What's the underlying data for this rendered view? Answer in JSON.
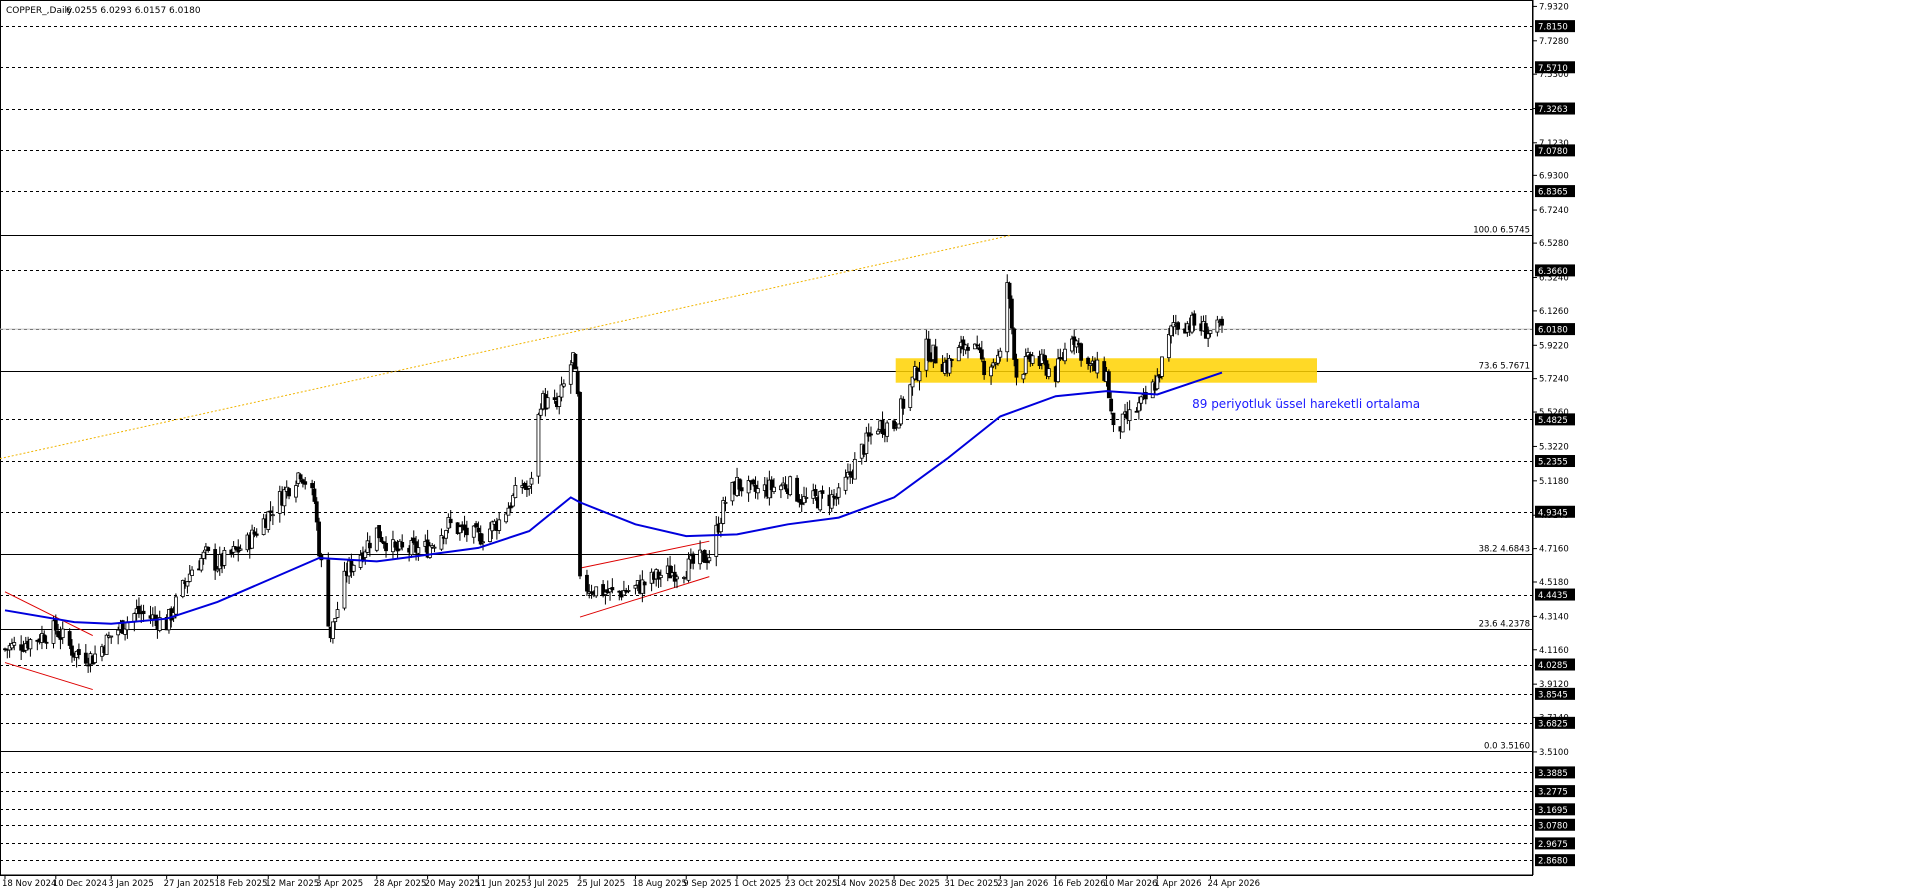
{
  "header": {
    "symbol": "COPPER_,Daily",
    "ohlc": "6.0255 6.0293 6.0157 6.0180"
  },
  "colors": {
    "background": "#ffffff",
    "grid": "#c0c0c0",
    "candle": "#000000",
    "ema": "#0000dd",
    "fib_line": "#000000",
    "fib_trend": "#f0b400",
    "zone": "#ffd200",
    "channel": "#dd0000",
    "price_box": "#000000",
    "price_text": "#ffffff",
    "annotation": "#1a1aff"
  },
  "price_axis": {
    "labels": [
      "7.9320",
      "7.7280",
      "7.5300",
      "7.3263",
      "7.1230",
      "6.9300",
      "6.7240",
      "6.5280",
      "6.3240",
      "6.1260",
      "5.9220",
      "5.7240",
      "5.5260",
      "5.3220",
      "5.1180",
      "4.9140",
      "4.7160",
      "4.5180",
      "4.3140",
      "4.1160",
      "3.9120",
      "3.7140",
      "3.5100"
    ],
    "boxed_levels": [
      "7.8150",
      "7.5710",
      "7.3263",
      "7.0780",
      "6.8365",
      "6.3660",
      "6.0180",
      "5.4825",
      "5.2355",
      "4.9345",
      "4.4435",
      "4.0285",
      "3.8545",
      "3.6825",
      "3.3885",
      "3.2775",
      "3.1695",
      "3.0780",
      "2.9675",
      "2.8680"
    ],
    "current_price": "6.0180"
  },
  "time_axis": {
    "labels": [
      "18 Nov 2024",
      "10 Dec 2024",
      "3 Jan 2025",
      "27 Jan 2025",
      "18 Feb 2025",
      "12 Mar 2025",
      "3 Apr 2025",
      "28 Apr 2025",
      "20 May 2025",
      "11 Jun 2025",
      "3 Jul 2025",
      "25 Jul 2025",
      "18 Aug 2025",
      "9 Sep 2025",
      "1 Oct 2025",
      "23 Oct 2025",
      "14 Nov 2025",
      "8 Dec 2025",
      "31 Dec 2025",
      "23 Jan 2026",
      "16 Feb 2026",
      "10 Mar 2026",
      "1 Apr 2026",
      "24 Apr 2026"
    ]
  },
  "fibonacci": [
    {
      "level": "100.0",
      "price": "6.5745"
    },
    {
      "level": "73.6",
      "price": "5.7671"
    },
    {
      "level": "38.2",
      "price": "4.6843"
    },
    {
      "level": "23.6",
      "price": "4.2378"
    },
    {
      "level": "0.0",
      "price": "3.5160"
    }
  ],
  "annotation": "89 periyotluk üssel hareketli ortalama",
  "chart_data": {
    "type": "candlestick",
    "title": "COPPER_,Daily",
    "ylim": [
      2.78,
      7.97
    ],
    "x_start": "18 Nov 2024",
    "x_end": "29 Apr 2026",
    "grid": false,
    "series": [
      {
        "name": "price",
        "close_path": [
          [
            "18 Nov 2024",
            4.12
          ],
          [
            "1 Dec 2024",
            4.18
          ],
          [
            "10 Dec 2024",
            4.24
          ],
          [
            "18 Dec 2024",
            4.1
          ],
          [
            "26 Dec 2024",
            4.07
          ],
          [
            "3 Jan 2025",
            4.2
          ],
          [
            "14 Jan 2025",
            4.34
          ],
          [
            "22 Jan 2025",
            4.3
          ],
          [
            "27 Jan 2025",
            4.27
          ],
          [
            "7 Feb 2025",
            4.6
          ],
          [
            "13 Feb 2025",
            4.68
          ],
          [
            "18 Feb 2025",
            4.62
          ],
          [
            "3 Mar 2025",
            4.75
          ],
          [
            "12 Mar 2025",
            4.92
          ],
          [
            "26 Mar 2025",
            5.18
          ],
          [
            "1 Apr 2025",
            5.0
          ],
          [
            "3 Apr 2025",
            4.72
          ],
          [
            "8 Apr 2025",
            4.2
          ],
          [
            "15 Apr 2025",
            4.58
          ],
          [
            "28 Apr 2025",
            4.82
          ],
          [
            "6 May 2025",
            4.7
          ],
          [
            "20 May 2025",
            4.72
          ],
          [
            "29 May 2025",
            4.86
          ],
          [
            "11 Jun 2025",
            4.78
          ],
          [
            "20 Jun 2025",
            4.88
          ],
          [
            "30 Jun 2025",
            5.1
          ],
          [
            "3 Jul 2025",
            5.05
          ],
          [
            "8 Jul 2025",
            5.6
          ],
          [
            "15 Jul 2025",
            5.55
          ],
          [
            "22 Jul 2025",
            5.85
          ],
          [
            "24 Jul 2025",
            5.6
          ],
          [
            "25 Jul 2025",
            4.5
          ],
          [
            "8 Aug 2025",
            4.45
          ],
          [
            "18 Aug 2025",
            4.48
          ],
          [
            "29 Aug 2025",
            4.56
          ],
          [
            "9 Sep 2025",
            4.6
          ],
          [
            "19 Sep 2025",
            4.68
          ],
          [
            "26 Sep 2025",
            5.0
          ],
          [
            "1 Oct 2025",
            5.1
          ],
          [
            "8 Oct 2025",
            5.05
          ],
          [
            "23 Oct 2025",
            5.1
          ],
          [
            "30 Oct 2025",
            5.0
          ],
          [
            "14 Nov 2025",
            5.02
          ],
          [
            "24 Nov 2025",
            5.3
          ],
          [
            "1 Dec 2025",
            5.45
          ],
          [
            "8 Dec 2025",
            5.45
          ],
          [
            "22 Dec 2025",
            5.9
          ],
          [
            "31 Dec 2025",
            5.8
          ],
          [
            "9 Jan 2026",
            5.95
          ],
          [
            "16 Jan 2026",
            5.8
          ],
          [
            "23 Jan 2026",
            5.85
          ],
          [
            "26 Jan 2026",
            6.3
          ],
          [
            "30 Jan 2026",
            5.75
          ],
          [
            "6 Feb 2026",
            5.85
          ],
          [
            "16 Feb 2026",
            5.75
          ],
          [
            "23 Feb 2026",
            6.0
          ],
          [
            "2 Mar 2026",
            5.8
          ],
          [
            "10 Mar 2026",
            5.75
          ],
          [
            "13 Mar 2026",
            5.4
          ],
          [
            "20 Mar 2026",
            5.5
          ],
          [
            "27 Mar 2026",
            5.6
          ],
          [
            "1 Apr 2026",
            5.72
          ],
          [
            "8 Apr 2026",
            6.05
          ],
          [
            "16 Apr 2026",
            6.05
          ],
          [
            "24 Apr 2026",
            6.0
          ],
          [
            "29 Apr 2026",
            6.02
          ]
        ]
      },
      {
        "name": "89 periyotluk üssel hareketli ortalama",
        "values": [
          [
            "18 Nov 2024",
            4.35
          ],
          [
            "18 Dec 2024",
            4.28
          ],
          [
            "3 Jan 2025",
            4.27
          ],
          [
            "27 Jan 2025",
            4.3
          ],
          [
            "18 Feb 2025",
            4.4
          ],
          [
            "12 Mar 2025",
            4.53
          ],
          [
            "3 Apr 2025",
            4.66
          ],
          [
            "28 Apr 2025",
            4.64
          ],
          [
            "20 May 2025",
            4.68
          ],
          [
            "11 Jun 2025",
            4.72
          ],
          [
            "3 Jul 2025",
            4.82
          ],
          [
            "21 Jul 2025",
            5.02
          ],
          [
            "25 Jul 2025",
            4.99
          ],
          [
            "18 Aug 2025",
            4.86
          ],
          [
            "9 Sep 2025",
            4.79
          ],
          [
            "1 Oct 2025",
            4.8
          ],
          [
            "23 Oct 2025",
            4.86
          ],
          [
            "14 Nov 2025",
            4.9
          ],
          [
            "8 Dec 2025",
            5.02
          ],
          [
            "31 Dec 2025",
            5.25
          ],
          [
            "23 Jan 2026",
            5.5
          ],
          [
            "16 Feb 2026",
            5.62
          ],
          [
            "10 Mar 2026",
            5.65
          ],
          [
            "1 Apr 2026",
            5.63
          ],
          [
            "29 Apr 2026",
            5.76
          ]
        ]
      }
    ]
  }
}
